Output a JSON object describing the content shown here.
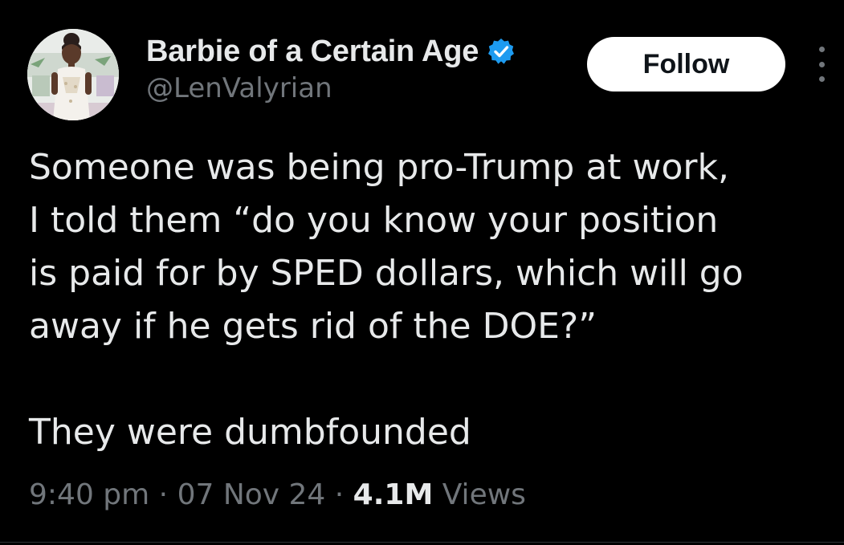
{
  "author": {
    "display_name": "Barbie of a Certain Age",
    "handle": "@LenValyrian",
    "verified": true,
    "verified_color": "#1d9bf0",
    "avatar_icon": "doll-avatar"
  },
  "actions": {
    "follow_label": "Follow",
    "more_icon": "vertical-ellipsis-icon"
  },
  "tweet": {
    "lines": [
      "Someone was being pro-Trump at work,",
      "I told them “do you know your position",
      "is paid for by SPED dollars, which will go",
      "away if he gets rid of the DOE?”",
      "",
      "They were dumbfounded"
    ]
  },
  "meta": {
    "time": "9:40 pm",
    "separator": " · ",
    "date": "07 Nov 24",
    "views_count": "4.1M",
    "views_label": " Views"
  },
  "colors": {
    "background": "#000000",
    "primary_text": "#e7e9ea",
    "secondary_text": "#71767b",
    "follow_bg": "#ffffff",
    "follow_text": "#0f1419"
  }
}
